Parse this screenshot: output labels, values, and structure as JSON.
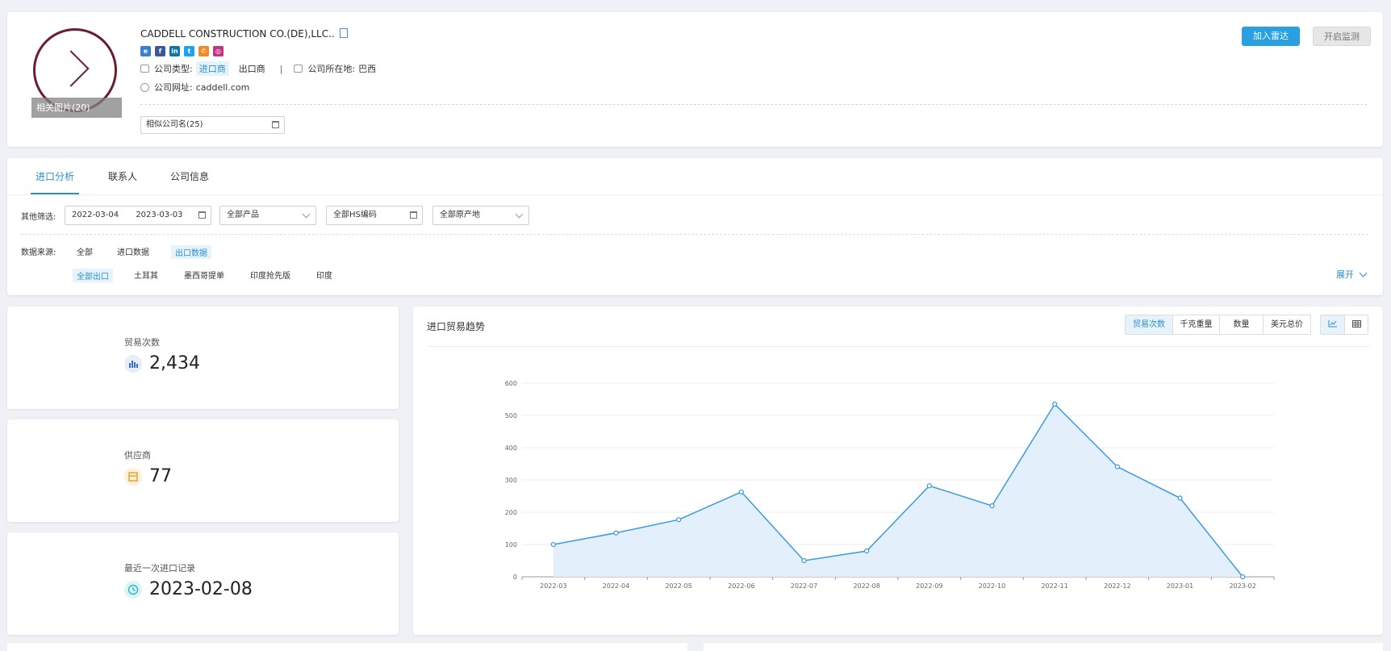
{
  "company": {
    "name": "CADDELL CONSTRUCTION CO.(DE),LLC..",
    "photos_label": "相关图片(20)",
    "type_label": "公司类型:",
    "type_importer": "进口商",
    "type_exporter": "出口商",
    "separator": "|",
    "location_label": "公司所在地:",
    "location_value": "巴西",
    "website_label": "公司网址:",
    "website_value": "caddell.com",
    "similar_names": "相似公司名(25)",
    "social_icons": [
      "web-icon",
      "facebook-icon",
      "linkedin-icon",
      "twitter-icon",
      "phone-icon",
      "instagram-icon"
    ],
    "btn_radar": "加入雷达",
    "btn_monitor": "开启监测"
  },
  "tabs": [
    "进口分析",
    "联系人",
    "公司信息"
  ],
  "filters": {
    "label": "其他筛选:",
    "date_start": "2022-03-04",
    "date_end": "2023-03-03",
    "product": "全部产品",
    "hs_code": "全部HS编码",
    "origin": "全部原产地"
  },
  "data_source": {
    "label": "数据来源:",
    "options": [
      "全部",
      "进口数据",
      "出口数据"
    ],
    "sub_options": [
      "全部出口",
      "土耳其",
      "墨西哥提单",
      "印度抢先版",
      "印度"
    ],
    "expand": "展开"
  },
  "stats": {
    "trades_label": "贸易次数",
    "trades_value": "2,434",
    "suppliers_label": "供应商",
    "suppliers_value": "77",
    "last_record_label": "最近一次进口记录",
    "last_record_value": "2023-02-08"
  },
  "chart_panel": {
    "title": "进口贸易趋势",
    "metrics": [
      "贸易次数",
      "千克重量",
      "数量",
      "美元总价"
    ],
    "active_metric": "贸易次数",
    "view_icons": [
      "line-chart-icon",
      "table-icon"
    ]
  },
  "colors": {
    "accent": "#2b8fd2",
    "button": "#2aa0e0",
    "line": "#3a9be0",
    "area": "#e3f0fb"
  },
  "chart_data": {
    "type": "area",
    "title": "",
    "xlabel": "",
    "ylabel": "",
    "categories": [
      "2022-03",
      "2022-04",
      "2022-05",
      "2022-06",
      "2022-07",
      "2022-08",
      "2022-09",
      "2022-10",
      "2022-11",
      "2022-12",
      "2023-01",
      "2023-02"
    ],
    "values": [
      100,
      136,
      177,
      263,
      50,
      80,
      282,
      220,
      535,
      341,
      244,
      0
    ],
    "ylim": [
      0,
      600
    ],
    "yticks": [
      0,
      100,
      200,
      300,
      400,
      500,
      600
    ],
    "grid": true
  }
}
